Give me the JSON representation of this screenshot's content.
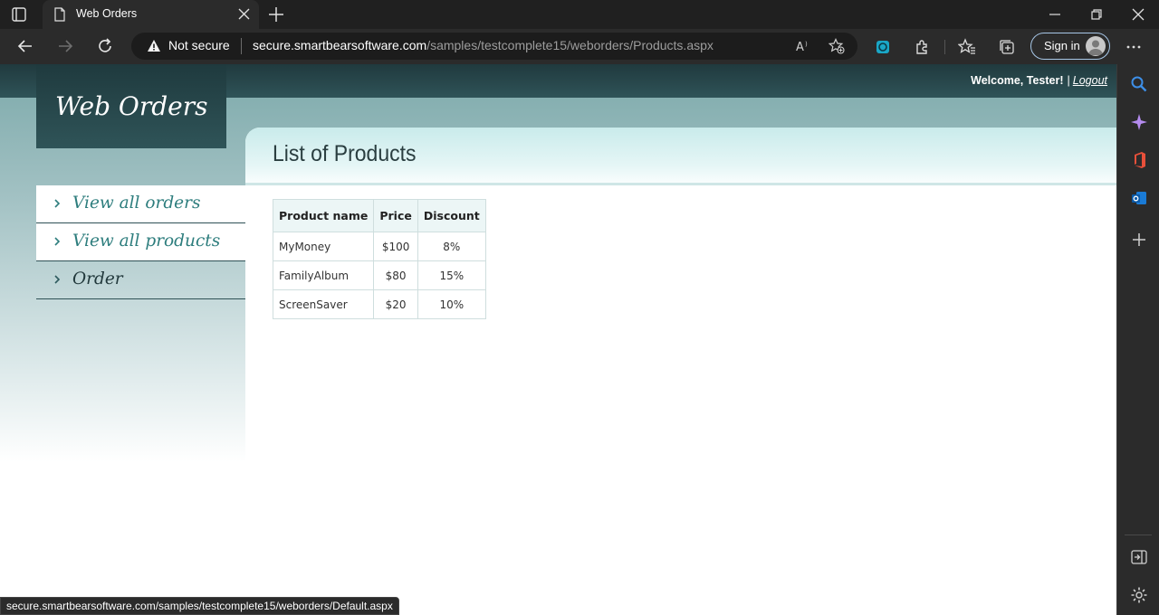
{
  "browser": {
    "tab_title": "Web Orders",
    "address": {
      "security_label": "Not secure",
      "url_host": "secure.smartbearsoftware.com",
      "url_path": "/samples/testcomplete15/weborders/Products.aspx"
    },
    "signin_label": "Sign in",
    "status_url": "secure.smartbearsoftware.com/samples/testcomplete15/weborders/Default.aspx"
  },
  "header": {
    "welcome_text": "Welcome, Tester!",
    "separator": "|",
    "logout_label": "Logout"
  },
  "logo": {
    "text": "Web Orders"
  },
  "menu": {
    "items": [
      {
        "label": "View all orders",
        "active": true
      },
      {
        "label": "View all products",
        "active": true
      },
      {
        "label": "Order",
        "active": false
      }
    ]
  },
  "main": {
    "title": "List of Products",
    "table": {
      "columns": [
        "Product name",
        "Price",
        "Discount"
      ],
      "rows": [
        [
          "MyMoney",
          "$100",
          "8%"
        ],
        [
          "FamilyAlbum",
          "$80",
          "15%"
        ],
        [
          "ScreenSaver",
          "$20",
          "10%"
        ]
      ]
    }
  },
  "colors": {
    "header_dark": "#203a3e",
    "accent_teal": "#2d7d7d",
    "content_head": "#c9ebeb",
    "browser_chrome": "#2b2b2b"
  },
  "icons": {
    "tab_actions": "tab-actions-icon",
    "favicon": "page-icon",
    "close": "close-icon",
    "new_tab": "plus-icon",
    "back": "back-arrow-icon",
    "forward": "forward-arrow-icon",
    "refresh": "refresh-icon",
    "warning": "warning-icon",
    "read_aloud": "read-aloud-icon",
    "add_favorite": "add-favorite-icon",
    "extension": "extensions-icon",
    "favorites": "favorites-icon",
    "collections": "collections-icon",
    "more": "more-icon",
    "chevron": "chevron-right-icon"
  }
}
